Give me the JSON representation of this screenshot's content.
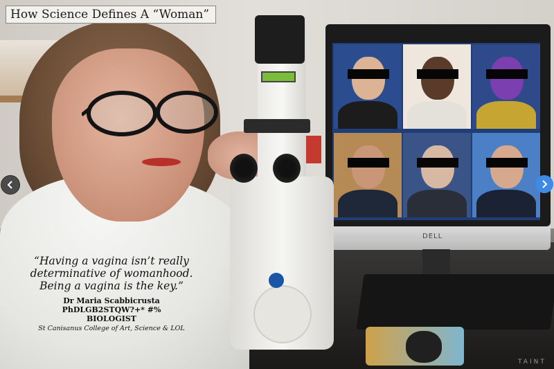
{
  "banner": {
    "title": "How Science Defines A “Woman”"
  },
  "quote": {
    "text": "“Having a vagina isn’t really determinative of womanhood. Being a vagina is the key.”",
    "name": "Dr Maria Scabbicrusta",
    "credentials": "PhDLGB2STQW?+* #%",
    "title": "BIOLOGIST",
    "institution": "St Canisanus College of Art, Science & LOL"
  },
  "monitor": {
    "brand": "DELL"
  },
  "watermark": "TAINT",
  "nav": {
    "prev_icon": "chevron-left-icon",
    "next_icon": "chevron-right-icon"
  },
  "colors": {
    "next_button": "#3d8be3",
    "prev_button": "#4a4a4a",
    "redaction": "#060606"
  }
}
